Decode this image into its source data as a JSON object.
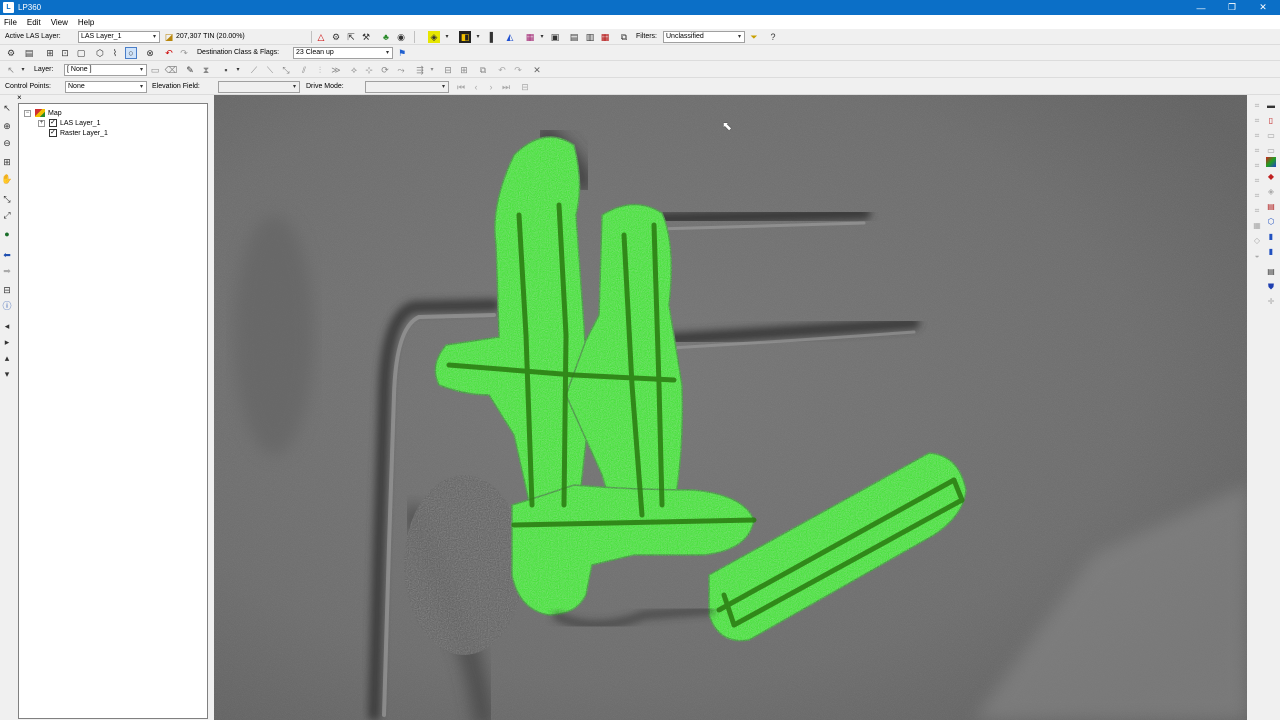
{
  "window": {
    "app_icon_text": "L",
    "title": "LP360",
    "minimize_glyph": "—",
    "restore_glyph": "❐",
    "close_glyph": "✕"
  },
  "menu": [
    "File",
    "Edit",
    "View",
    "Help"
  ],
  "toolbar1": {
    "active_las_label": "Active LAS Layer:",
    "active_las_value": "LAS Layer_1",
    "point_count": "207,307 TIN (20.00%)",
    "filters_label": "Filters:",
    "filters_value": "Unclassified"
  },
  "toolbar2": {
    "destination_label": "Destination Class & Flags:",
    "destination_value": "23 Clean up"
  },
  "toolbar3": {
    "layer_label": "Layer:",
    "layer_value": "[ None ]"
  },
  "toolbar4": {
    "control_points_label": "Control Points:",
    "control_points_value": "None",
    "elevation_field_label": "Elevation Field:",
    "elevation_field_value": "",
    "drive_mode_label": "Drive Mode:",
    "drive_mode_value": ""
  },
  "tree": {
    "close_glyph": "×",
    "root": "Map",
    "layers": [
      {
        "name": "LAS Layer_1",
        "checked": true,
        "expandable": true
      },
      {
        "name": "Raster Layer_1",
        "checked": true,
        "expandable": false
      }
    ]
  },
  "colors": {
    "titlebar": "#0b6fc7",
    "highlight": "#2fe80a",
    "terrain": "#6a6a6a"
  }
}
